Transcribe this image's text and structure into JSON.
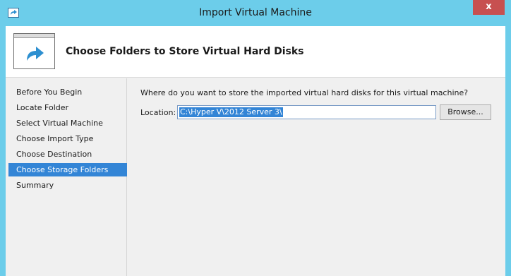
{
  "window": {
    "title": "Import Virtual Machine",
    "close_label": "x"
  },
  "header": {
    "title": "Choose Folders to Store Virtual Hard Disks"
  },
  "nav": {
    "items": [
      {
        "label": "Before You Begin"
      },
      {
        "label": "Locate Folder"
      },
      {
        "label": "Select Virtual Machine"
      },
      {
        "label": "Choose Import Type"
      },
      {
        "label": "Choose Destination"
      },
      {
        "label": "Choose Storage Folders",
        "active": true
      },
      {
        "label": "Summary"
      }
    ]
  },
  "content": {
    "question": "Where do you want to store the imported virtual hard disks for this virtual machine?",
    "location_label": "Location:",
    "location_value": "C:\\Hyper V\\2012 Server 3\\",
    "browse_label": "Browse..."
  },
  "colors": {
    "titlebar": "#6ccdea",
    "selection": "#3385d6",
    "close": "#c75050"
  }
}
